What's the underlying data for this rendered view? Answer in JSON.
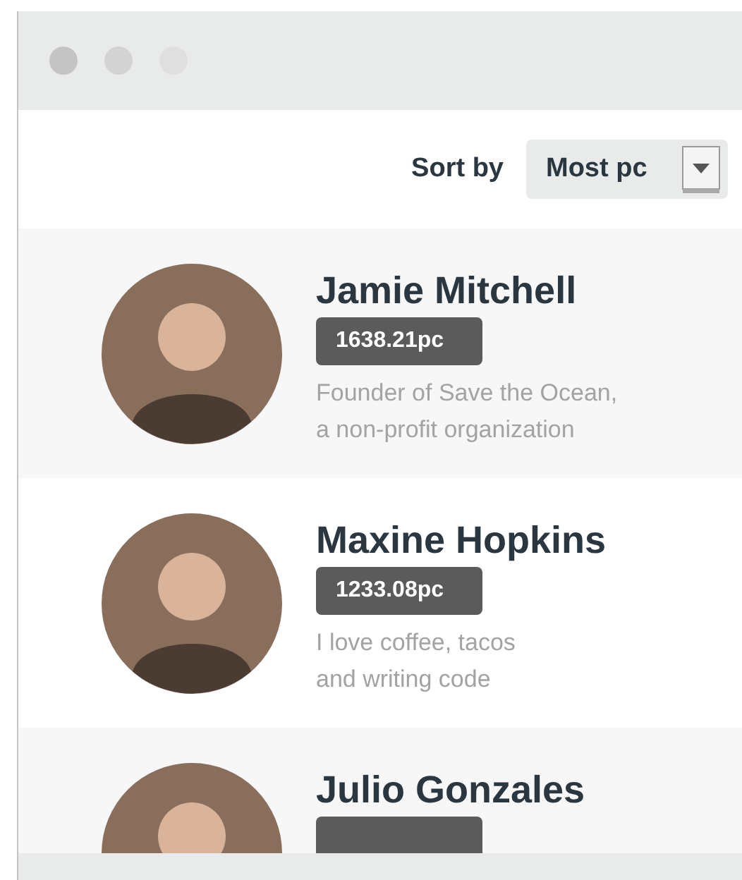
{
  "sort": {
    "label": "Sort by",
    "value": "Most pc"
  },
  "people": [
    {
      "name": "Jamie Mitchell",
      "points": "1638.21pc",
      "bio": "Founder of Save the Ocean,\na non-profit organization"
    },
    {
      "name": "Maxine Hopkins",
      "points": "1233.08pc",
      "bio": "I love coffee, tacos\nand writing code"
    },
    {
      "name": "Julio Gonzales"
    }
  ]
}
